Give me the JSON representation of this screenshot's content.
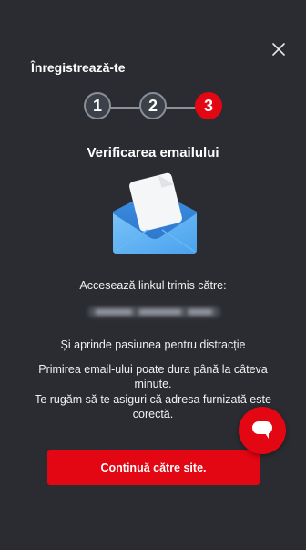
{
  "header": {
    "title": "Înregistrează-te",
    "close_icon": "close-icon"
  },
  "stepper": {
    "steps": [
      {
        "label": "1",
        "state": "completed"
      },
      {
        "label": "2",
        "state": "completed"
      },
      {
        "label": "3",
        "state": "active"
      }
    ]
  },
  "main": {
    "heading": "Verificarea emailului",
    "envelope_icon": "open-envelope-icon",
    "sent_to_label": "Accesează linkul trimis către:",
    "tagline": "Și aprinde pasiunea pentru distracție",
    "delay_note_line1": "Primirea email-ului poate dura până la câteva",
    "delay_note_line2": "minute.",
    "check_address_line1": "Te rugăm să te asiguri că adresa furnizată este",
    "check_address_line2": "corectă."
  },
  "actions": {
    "continue_label": "Continuă către site."
  },
  "chat": {
    "icon": "chat-bubble-icon"
  },
  "colors": {
    "background": "#2a2c31",
    "accent": "#e30613",
    "step_done": "#3b4049"
  }
}
